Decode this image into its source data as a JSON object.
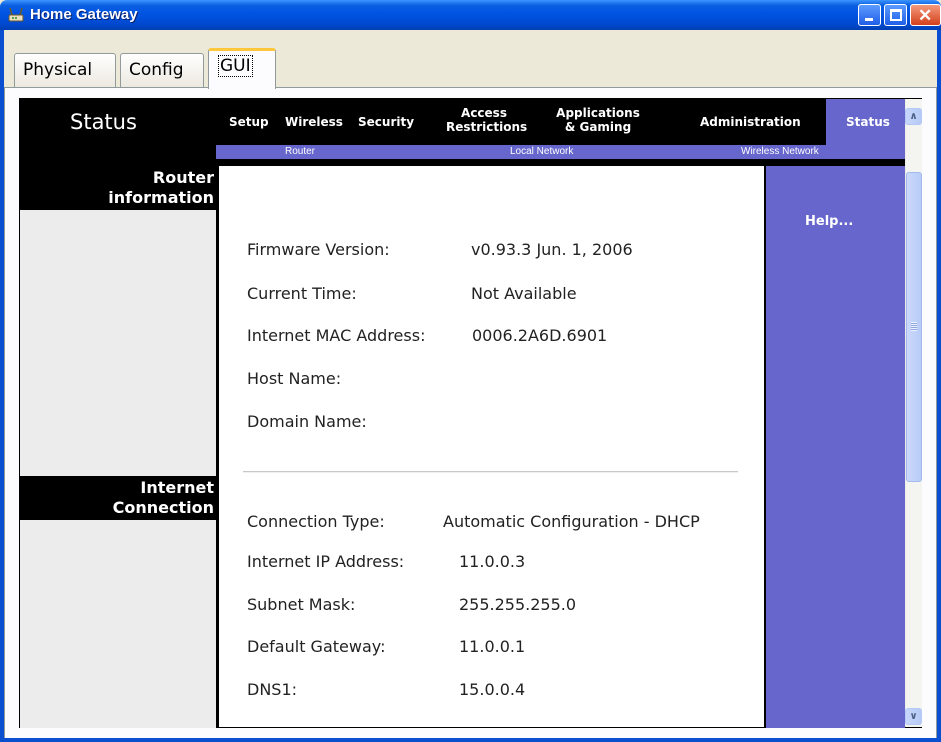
{
  "window": {
    "title": "Home Gateway",
    "icons": [
      "router-app-icon",
      "minimize-icon",
      "maximize-icon",
      "close-icon"
    ]
  },
  "tabs": [
    {
      "label": "Physical"
    },
    {
      "label": "Config"
    },
    {
      "label": "GUI"
    }
  ],
  "router_ui": {
    "heading": "Status",
    "nav": {
      "setup": "Setup",
      "wireless": "Wireless",
      "security": "Security",
      "access_1": "Access",
      "access_2": "Restrictions",
      "apps_1": "Applications",
      "apps_2": "& Gaming",
      "administration": "Administration",
      "status": "Status"
    },
    "subnav": {
      "router": "Router",
      "local_network": "Local Network",
      "wireless_network": "Wireless Network"
    },
    "sections": {
      "router_info_1": "Router",
      "router_info_2": "information",
      "internet_1": "Internet",
      "internet_2": "Connection"
    },
    "help": "Help...",
    "router_information": [
      {
        "label": "Firmware Version:",
        "value": "v0.93.3 Jun. 1, 2006"
      },
      {
        "label": "Current Time:",
        "value": "Not Available"
      },
      {
        "label": "Internet MAC Address:",
        "value": "0006.2A6D.6901"
      },
      {
        "label": "Host Name:",
        "value": ""
      },
      {
        "label": "Domain Name:",
        "value": ""
      }
    ],
    "internet_connection": [
      {
        "label": "Connection Type:",
        "value": "Automatic Configuration - DHCP"
      },
      {
        "label": "Internet IP Address:",
        "value": "11.0.0.3"
      },
      {
        "label": "Subnet Mask:",
        "value": "255.255.255.0"
      },
      {
        "label": "Default Gateway:",
        "value": "11.0.0.1"
      },
      {
        "label": "DNS1:",
        "value": "15.0.0.4"
      }
    ]
  },
  "scrollbar": {
    "up_glyph": "∧",
    "down_glyph": "∨"
  },
  "colors": {
    "titlebar": "#0054e3",
    "nav_black": "#000000",
    "accent_purple": "#6666cc",
    "side_grey": "#ececec",
    "tab_highlight": "#ffc83c"
  }
}
